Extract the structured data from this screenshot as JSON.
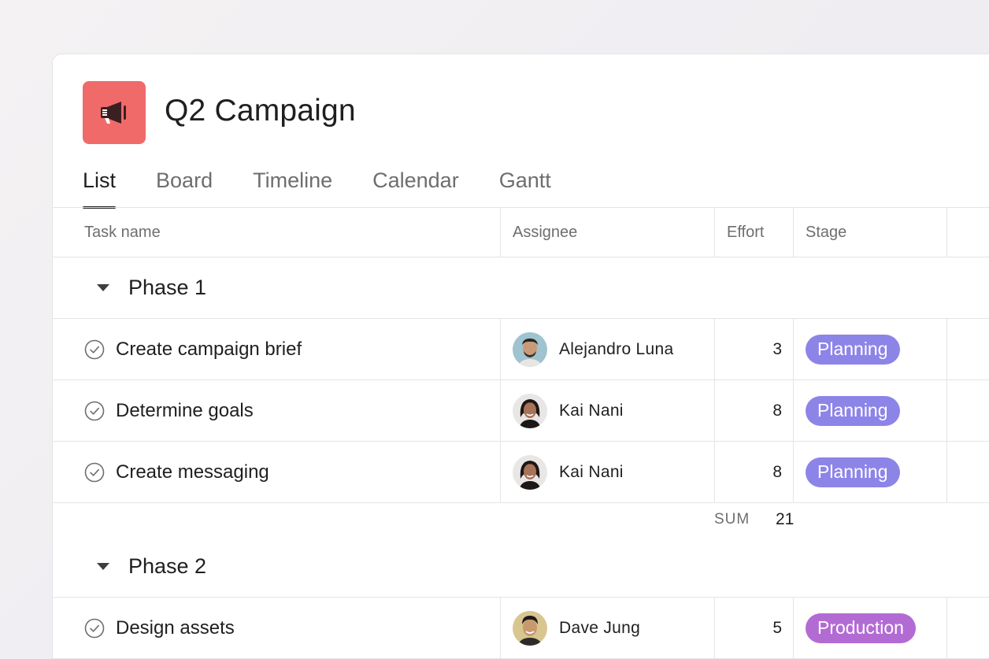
{
  "project": {
    "title": "Q2 Campaign",
    "icon": "megaphone-icon",
    "icon_bg": "#f06a6a"
  },
  "tabs": [
    {
      "label": "List",
      "active": true
    },
    {
      "label": "Board",
      "active": false
    },
    {
      "label": "Timeline",
      "active": false
    },
    {
      "label": "Calendar",
      "active": false
    },
    {
      "label": "Gantt",
      "active": false
    }
  ],
  "columns": {
    "task": "Task name",
    "assignee": "Assignee",
    "effort": "Effort",
    "stage": "Stage"
  },
  "sections": [
    {
      "title": "Phase 1",
      "tasks": [
        {
          "name": "Create campaign brief",
          "assignee": "Alejandro Luna",
          "effort": "3",
          "stage": "Planning"
        },
        {
          "name": "Determine goals",
          "assignee": "Kai Nani",
          "effort": "8",
          "stage": "Planning"
        },
        {
          "name": "Create messaging",
          "assignee": "Kai Nani",
          "effort": "8",
          "stage": "Planning"
        }
      ],
      "sum_label": "SUM",
      "sum_value": "21"
    },
    {
      "title": "Phase 2",
      "tasks": [
        {
          "name": "Design assets",
          "assignee": "Dave Jung",
          "effort": "5",
          "stage": "Production"
        }
      ]
    }
  ],
  "colors": {
    "planning": "#8d84e8",
    "production": "#b36bd4",
    "text_primary": "#1e1f21",
    "text_secondary": "#6d6e6f"
  }
}
